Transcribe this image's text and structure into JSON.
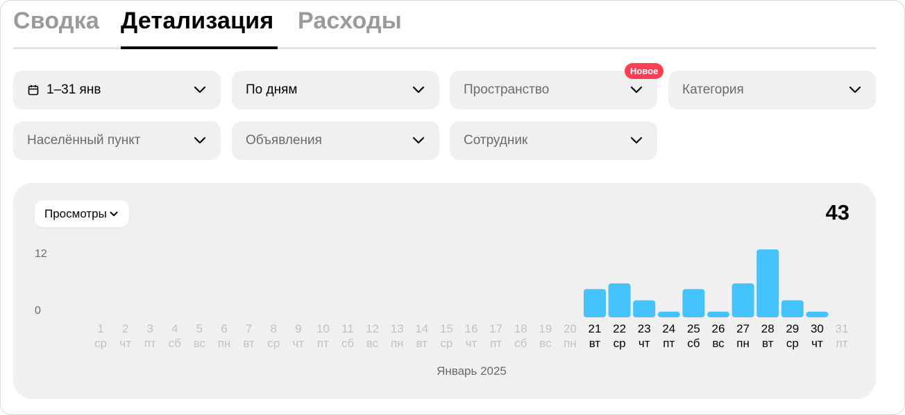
{
  "tabs": [
    {
      "label": "Сводка",
      "active": false
    },
    {
      "label": "Детализация",
      "active": true
    },
    {
      "label": "Расходы",
      "active": false
    }
  ],
  "filters": {
    "period": {
      "value": "1–31 янв",
      "icon": "calendar-icon"
    },
    "grouping": {
      "value": "По дням"
    },
    "space": {
      "placeholder": "Пространство",
      "badge": "Новое"
    },
    "category": {
      "placeholder": "Категория"
    },
    "locality": {
      "placeholder": "Населённый пункт"
    },
    "listings": {
      "placeholder": "Объявления"
    },
    "employee": {
      "placeholder": "Сотрудник"
    }
  },
  "colors": {
    "bar": "#45c3ff",
    "badge": "#ff4053",
    "muted_text": "#c2c2c2",
    "active_tab": "#000000",
    "inactive_tab": "#9a9a9a"
  },
  "chart_data": {
    "type": "bar",
    "metric": "Просмотры",
    "total": "43",
    "yticks": [
      "12",
      "0"
    ],
    "ylim": [
      0,
      12
    ],
    "xlabel": "Январь 2025",
    "categories": [
      "1",
      "2",
      "3",
      "4",
      "5",
      "6",
      "7",
      "8",
      "9",
      "10",
      "11",
      "12",
      "13",
      "14",
      "15",
      "16",
      "17",
      "18",
      "19",
      "20",
      "21",
      "22",
      "23",
      "24",
      "25",
      "26",
      "27",
      "28",
      "29",
      "30",
      "31"
    ],
    "weekdays": [
      "ср",
      "чт",
      "пт",
      "сб",
      "вс",
      "пн",
      "вт",
      "ср",
      "чт",
      "пт",
      "сб",
      "вс",
      "пн",
      "вт",
      "ср",
      "чт",
      "пт",
      "сб",
      "вс",
      "пн",
      "вт",
      "ср",
      "чт",
      "пт",
      "сб",
      "вс",
      "пн",
      "вт",
      "ср",
      "чт",
      "пт"
    ],
    "values": [
      0,
      0,
      0,
      0,
      0,
      0,
      0,
      0,
      0,
      0,
      0,
      0,
      0,
      0,
      0,
      0,
      0,
      0,
      0,
      0,
      5,
      6,
      3,
      1,
      5,
      1,
      6,
      12,
      3,
      1,
      0
    ],
    "has_data": [
      false,
      false,
      false,
      false,
      false,
      false,
      false,
      false,
      false,
      false,
      false,
      false,
      false,
      false,
      false,
      false,
      false,
      false,
      false,
      false,
      true,
      true,
      true,
      true,
      true,
      true,
      true,
      true,
      true,
      true,
      false
    ]
  }
}
